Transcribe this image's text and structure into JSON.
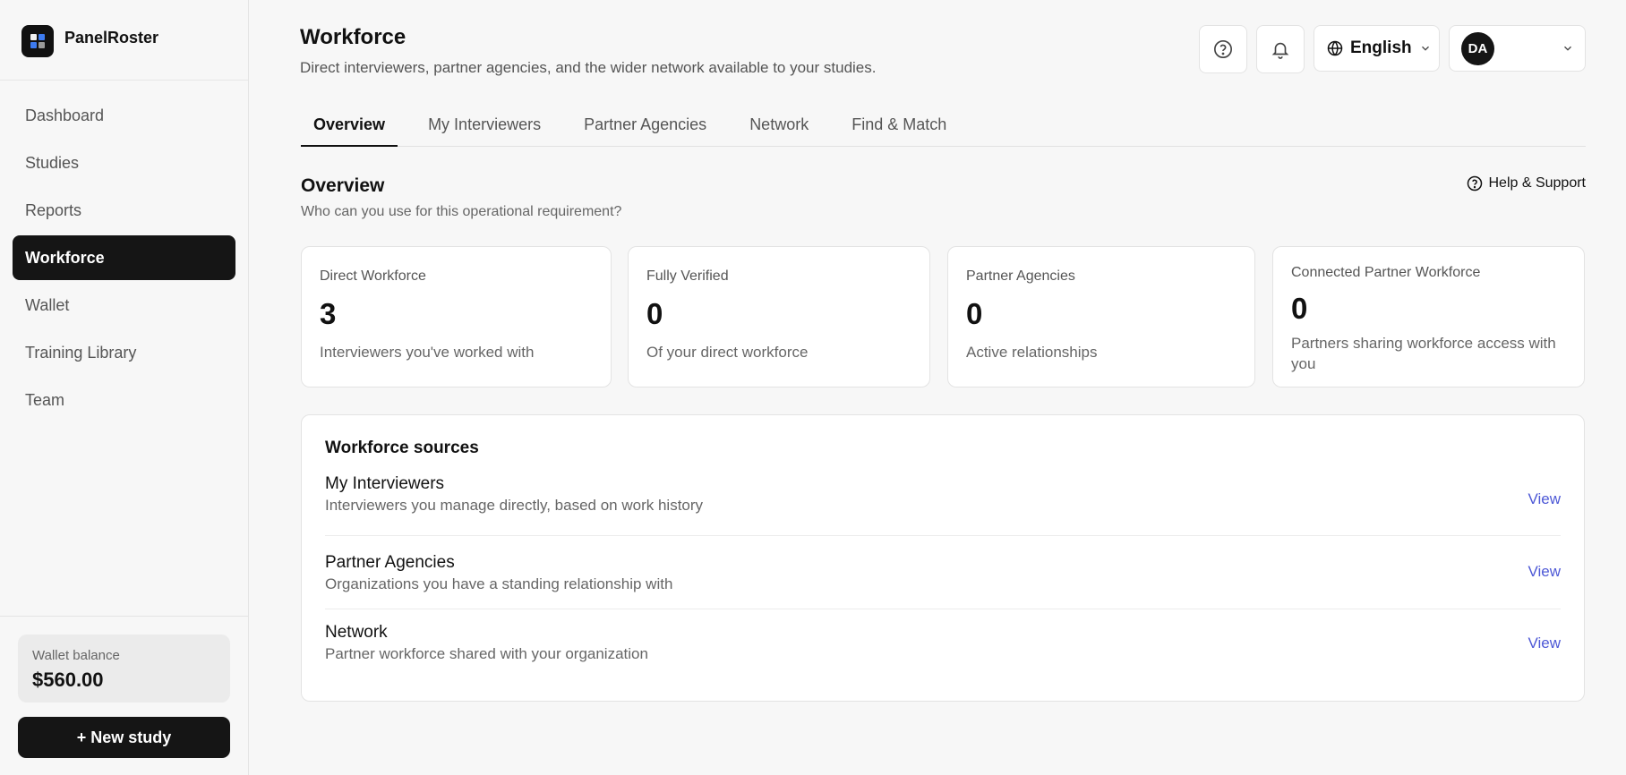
{
  "app": {
    "name": "PanelRoster"
  },
  "sidebar": {
    "items": [
      {
        "label": "Dashboard"
      },
      {
        "label": "Studies"
      },
      {
        "label": "Reports"
      },
      {
        "label": "Workforce",
        "active": true
      },
      {
        "label": "Wallet"
      },
      {
        "label": "Training Library"
      },
      {
        "label": "Team"
      }
    ],
    "wallet": {
      "label": "Wallet balance",
      "value": "$560.00"
    },
    "new_study_label": "+ New study"
  },
  "header": {
    "title": "Workforce",
    "subtitle": "Direct interviewers, partner agencies, and the wider network available to your studies.",
    "language": "English",
    "user_initials": "DA",
    "icons": [
      "help-circle-icon",
      "bell-icon",
      "globe-icon",
      "chevron-down-icon"
    ]
  },
  "tabs": [
    {
      "label": "Overview",
      "active": true
    },
    {
      "label": "My Interviewers"
    },
    {
      "label": "Partner Agencies"
    },
    {
      "label": "Network"
    },
    {
      "label": "Find & Match"
    }
  ],
  "overview": {
    "title": "Overview",
    "subtitle": "Who can you use for this operational requirement?",
    "help_label": "Help & Support",
    "stats": [
      {
        "label": "Direct Workforce",
        "value": "3",
        "desc": "Interviewers you've worked with"
      },
      {
        "label": "Fully Verified",
        "value": "0",
        "desc": "Of your direct workforce"
      },
      {
        "label": "Partner Agencies",
        "value": "0",
        "desc": "Active relationships"
      },
      {
        "label": "Connected Partner Workforce",
        "value": "0",
        "desc": "Partners sharing workforce access with you"
      }
    ]
  },
  "sources": {
    "title": "Workforce sources",
    "rows": [
      {
        "name": "My Interviewers",
        "desc": "Interviewers you manage directly, based on work history",
        "link": "View"
      },
      {
        "name": "Partner Agencies",
        "desc": "Organizations you have a standing relationship with",
        "link": "View"
      },
      {
        "name": "Network",
        "desc": "Partner workforce shared with your organization",
        "link": "View"
      }
    ]
  },
  "colors": {
    "accent": "#4d58d6",
    "dark": "#151515",
    "background": "#f7f7f7"
  }
}
